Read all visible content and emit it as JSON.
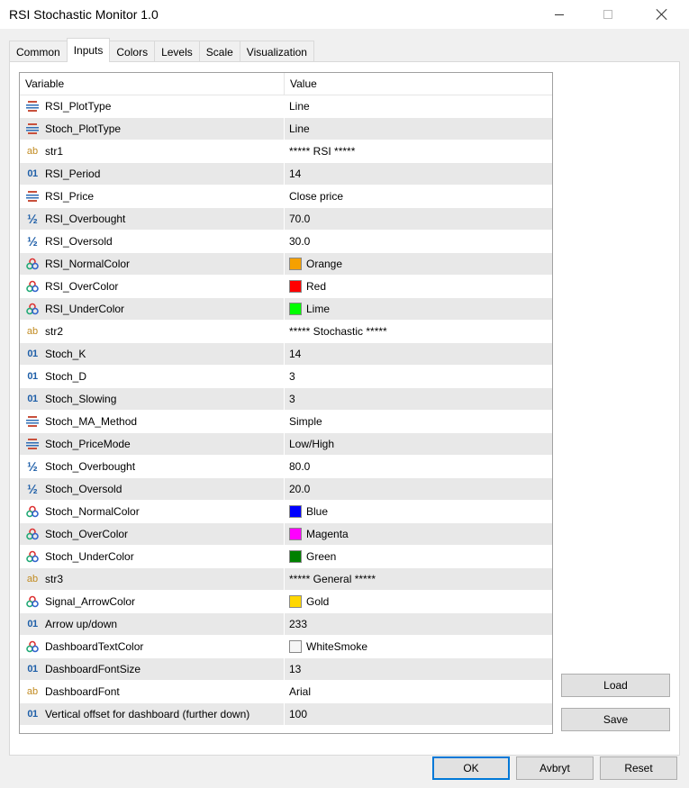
{
  "window": {
    "title": "RSI Stochastic Monitor 1.0"
  },
  "tabs": [
    "Common",
    "Inputs",
    "Colors",
    "Levels",
    "Scale",
    "Visualization"
  ],
  "active_tab": "Inputs",
  "grid": {
    "headers": {
      "variable": "Variable",
      "value": "Value"
    },
    "rows": [
      {
        "icon": "enum-icon",
        "name": "RSI_PlotType",
        "value": "Line"
      },
      {
        "icon": "enum-icon",
        "name": "Stoch_PlotType",
        "value": "Line"
      },
      {
        "icon": "text-icon",
        "name": "str1",
        "value": "***** RSI *****"
      },
      {
        "icon": "integer-icon",
        "name": "RSI_Period",
        "value": "14"
      },
      {
        "icon": "enum-icon",
        "name": "RSI_Price",
        "value": "Close price"
      },
      {
        "icon": "double-icon",
        "name": "RSI_Overbought",
        "value": "70.0"
      },
      {
        "icon": "double-icon",
        "name": "RSI_Oversold",
        "value": "30.0"
      },
      {
        "icon": "color-icon",
        "name": "RSI_NormalColor",
        "value": "Orange",
        "swatch": "#f5a000"
      },
      {
        "icon": "color-icon",
        "name": "RSI_OverColor",
        "value": "Red",
        "swatch": "#ff0000"
      },
      {
        "icon": "color-icon",
        "name": "RSI_UnderColor",
        "value": "Lime",
        "swatch": "#00ff00"
      },
      {
        "icon": "text-icon",
        "name": "str2",
        "value": "***** Stochastic *****"
      },
      {
        "icon": "integer-icon",
        "name": "Stoch_K",
        "value": "14"
      },
      {
        "icon": "integer-icon",
        "name": "Stoch_D",
        "value": "3"
      },
      {
        "icon": "integer-icon",
        "name": "Stoch_Slowing",
        "value": "3"
      },
      {
        "icon": "enum-icon",
        "name": "Stoch_MA_Method",
        "value": "Simple"
      },
      {
        "icon": "enum-icon",
        "name": "Stoch_PriceMode",
        "value": "Low/High"
      },
      {
        "icon": "double-icon",
        "name": "Stoch_Overbought",
        "value": "80.0"
      },
      {
        "icon": "double-icon",
        "name": "Stoch_Oversold",
        "value": "20.0"
      },
      {
        "icon": "color-icon",
        "name": "Stoch_NormalColor",
        "value": "Blue",
        "swatch": "#0000ff"
      },
      {
        "icon": "color-icon",
        "name": "Stoch_OverColor",
        "value": "Magenta",
        "swatch": "#ff00ff"
      },
      {
        "icon": "color-icon",
        "name": "Stoch_UnderColor",
        "value": "Green",
        "swatch": "#008000"
      },
      {
        "icon": "text-icon",
        "name": "str3",
        "value": "***** General *****"
      },
      {
        "icon": "color-icon",
        "name": "Signal_ArrowColor",
        "value": "Gold",
        "swatch": "#ffd700"
      },
      {
        "icon": "integer-icon",
        "name": "Arrow up/down",
        "value": "233"
      },
      {
        "icon": "color-icon",
        "name": "DashboardTextColor",
        "value": "WhiteSmoke",
        "swatch": "#f5f5f5"
      },
      {
        "icon": "integer-icon",
        "name": "DashboardFontSize",
        "value": "13"
      },
      {
        "icon": "text-icon",
        "name": "DashboardFont",
        "value": "Arial"
      },
      {
        "icon": "integer-icon",
        "name": "Vertical offset for dashboard (further down)",
        "value": "100"
      }
    ]
  },
  "buttons": {
    "load": "Load",
    "save": "Save",
    "ok": "OK",
    "cancel": "Avbryt",
    "reset": "Reset"
  }
}
